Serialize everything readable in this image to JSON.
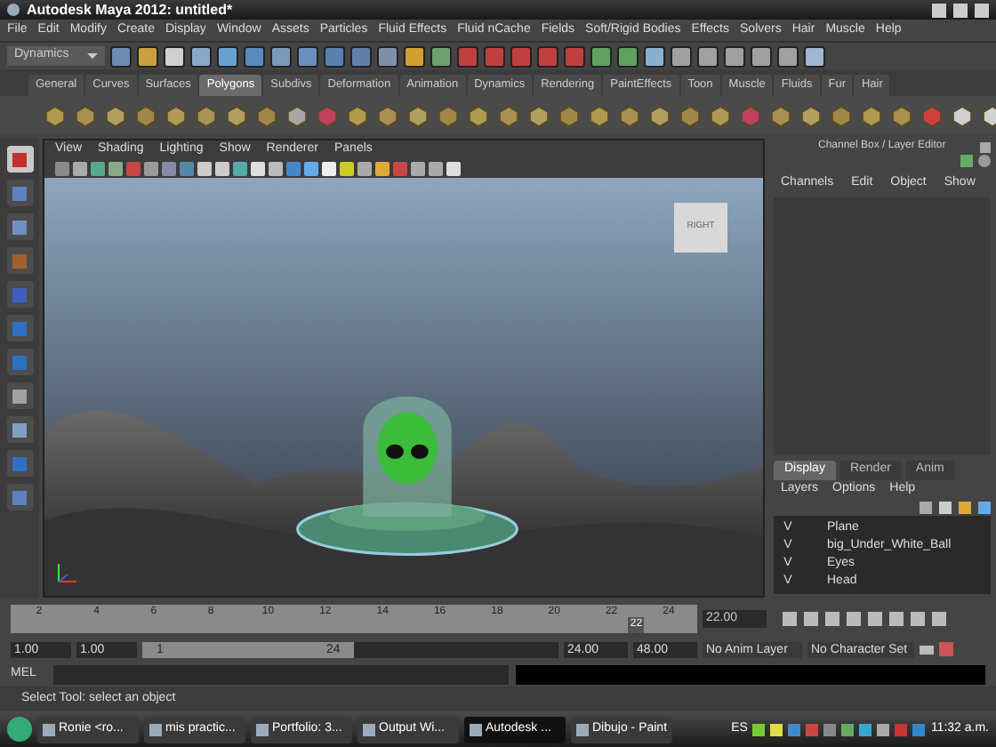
{
  "window": {
    "title": "Autodesk Maya 2012: untitled*"
  },
  "menu": [
    "File",
    "Edit",
    "Modify",
    "Create",
    "Display",
    "Window",
    "Assets",
    "Particles",
    "Fluid Effects",
    "Fluid nCache",
    "Fields",
    "Soft/Rigid Bodies",
    "Effects",
    "Solvers",
    "Hair",
    "Muscle",
    "Help"
  ],
  "menu_set": {
    "value": "Dynamics"
  },
  "shelf_tabs": [
    {
      "label": "General",
      "selected": false
    },
    {
      "label": "Curves",
      "selected": false
    },
    {
      "label": "Surfaces",
      "selected": false
    },
    {
      "label": "Polygons",
      "selected": true
    },
    {
      "label": "Subdivs",
      "selected": false
    },
    {
      "label": "Deformation",
      "selected": false
    },
    {
      "label": "Animation",
      "selected": false
    },
    {
      "label": "Dynamics",
      "selected": false
    },
    {
      "label": "Rendering",
      "selected": false
    },
    {
      "label": "PaintEffects",
      "selected": false
    },
    {
      "label": "Toon",
      "selected": false
    },
    {
      "label": "Muscle",
      "selected": false
    },
    {
      "label": "Fluids",
      "selected": false
    },
    {
      "label": "Fur",
      "selected": false
    },
    {
      "label": "Hair",
      "selected": false
    }
  ],
  "viewport": {
    "menu": [
      "View",
      "Shading",
      "Lighting",
      "Show",
      "Renderer",
      "Panels"
    ],
    "view_cube": "RIGHT"
  },
  "channel_box": {
    "title": "Channel Box / Layer Editor",
    "menu": [
      "Channels",
      "Edit",
      "Object",
      "Show"
    ],
    "layer_tabs": [
      {
        "label": "Display",
        "selected": true
      },
      {
        "label": "Render",
        "selected": false
      },
      {
        "label": "Anim",
        "selected": false
      }
    ],
    "layer_menu": [
      "Layers",
      "Options",
      "Help"
    ],
    "layers": [
      {
        "visible": "V",
        "name": "Plane"
      },
      {
        "visible": "V",
        "name": "big_Under_White_Ball"
      },
      {
        "visible": "V",
        "name": "Eyes"
      },
      {
        "visible": "V",
        "name": "Head"
      }
    ]
  },
  "timeline": {
    "ticks": [
      "2",
      "4",
      "6",
      "8",
      "10",
      "12",
      "14",
      "16",
      "18",
      "20",
      "22",
      "24"
    ],
    "current_frame": "22",
    "current_time": "22.00",
    "level": 0.9
  },
  "range": {
    "start": "1.00",
    "playback_start": "1.00",
    "slider_start": "1",
    "slider_end": "24",
    "level": 0.51,
    "playback_end": "24.00",
    "end": "48.00",
    "anim_layer": "No Anim Layer",
    "character_set": "No Character Set"
  },
  "command_line": {
    "label": "MEL"
  },
  "help_line": "Select Tool: select an object",
  "taskbar": {
    "items": [
      {
        "label": "Ronie <ro...",
        "active": false
      },
      {
        "label": "mis practic...",
        "active": false
      },
      {
        "label": "Portfolio: 3...",
        "active": false
      },
      {
        "label": "Output Wi...",
        "active": false
      },
      {
        "label": "Autodesk ...",
        "active": true
      },
      {
        "label": "Dibujo - Paint",
        "active": false
      }
    ],
    "language": "ES",
    "clock": "11:32 a.m."
  }
}
